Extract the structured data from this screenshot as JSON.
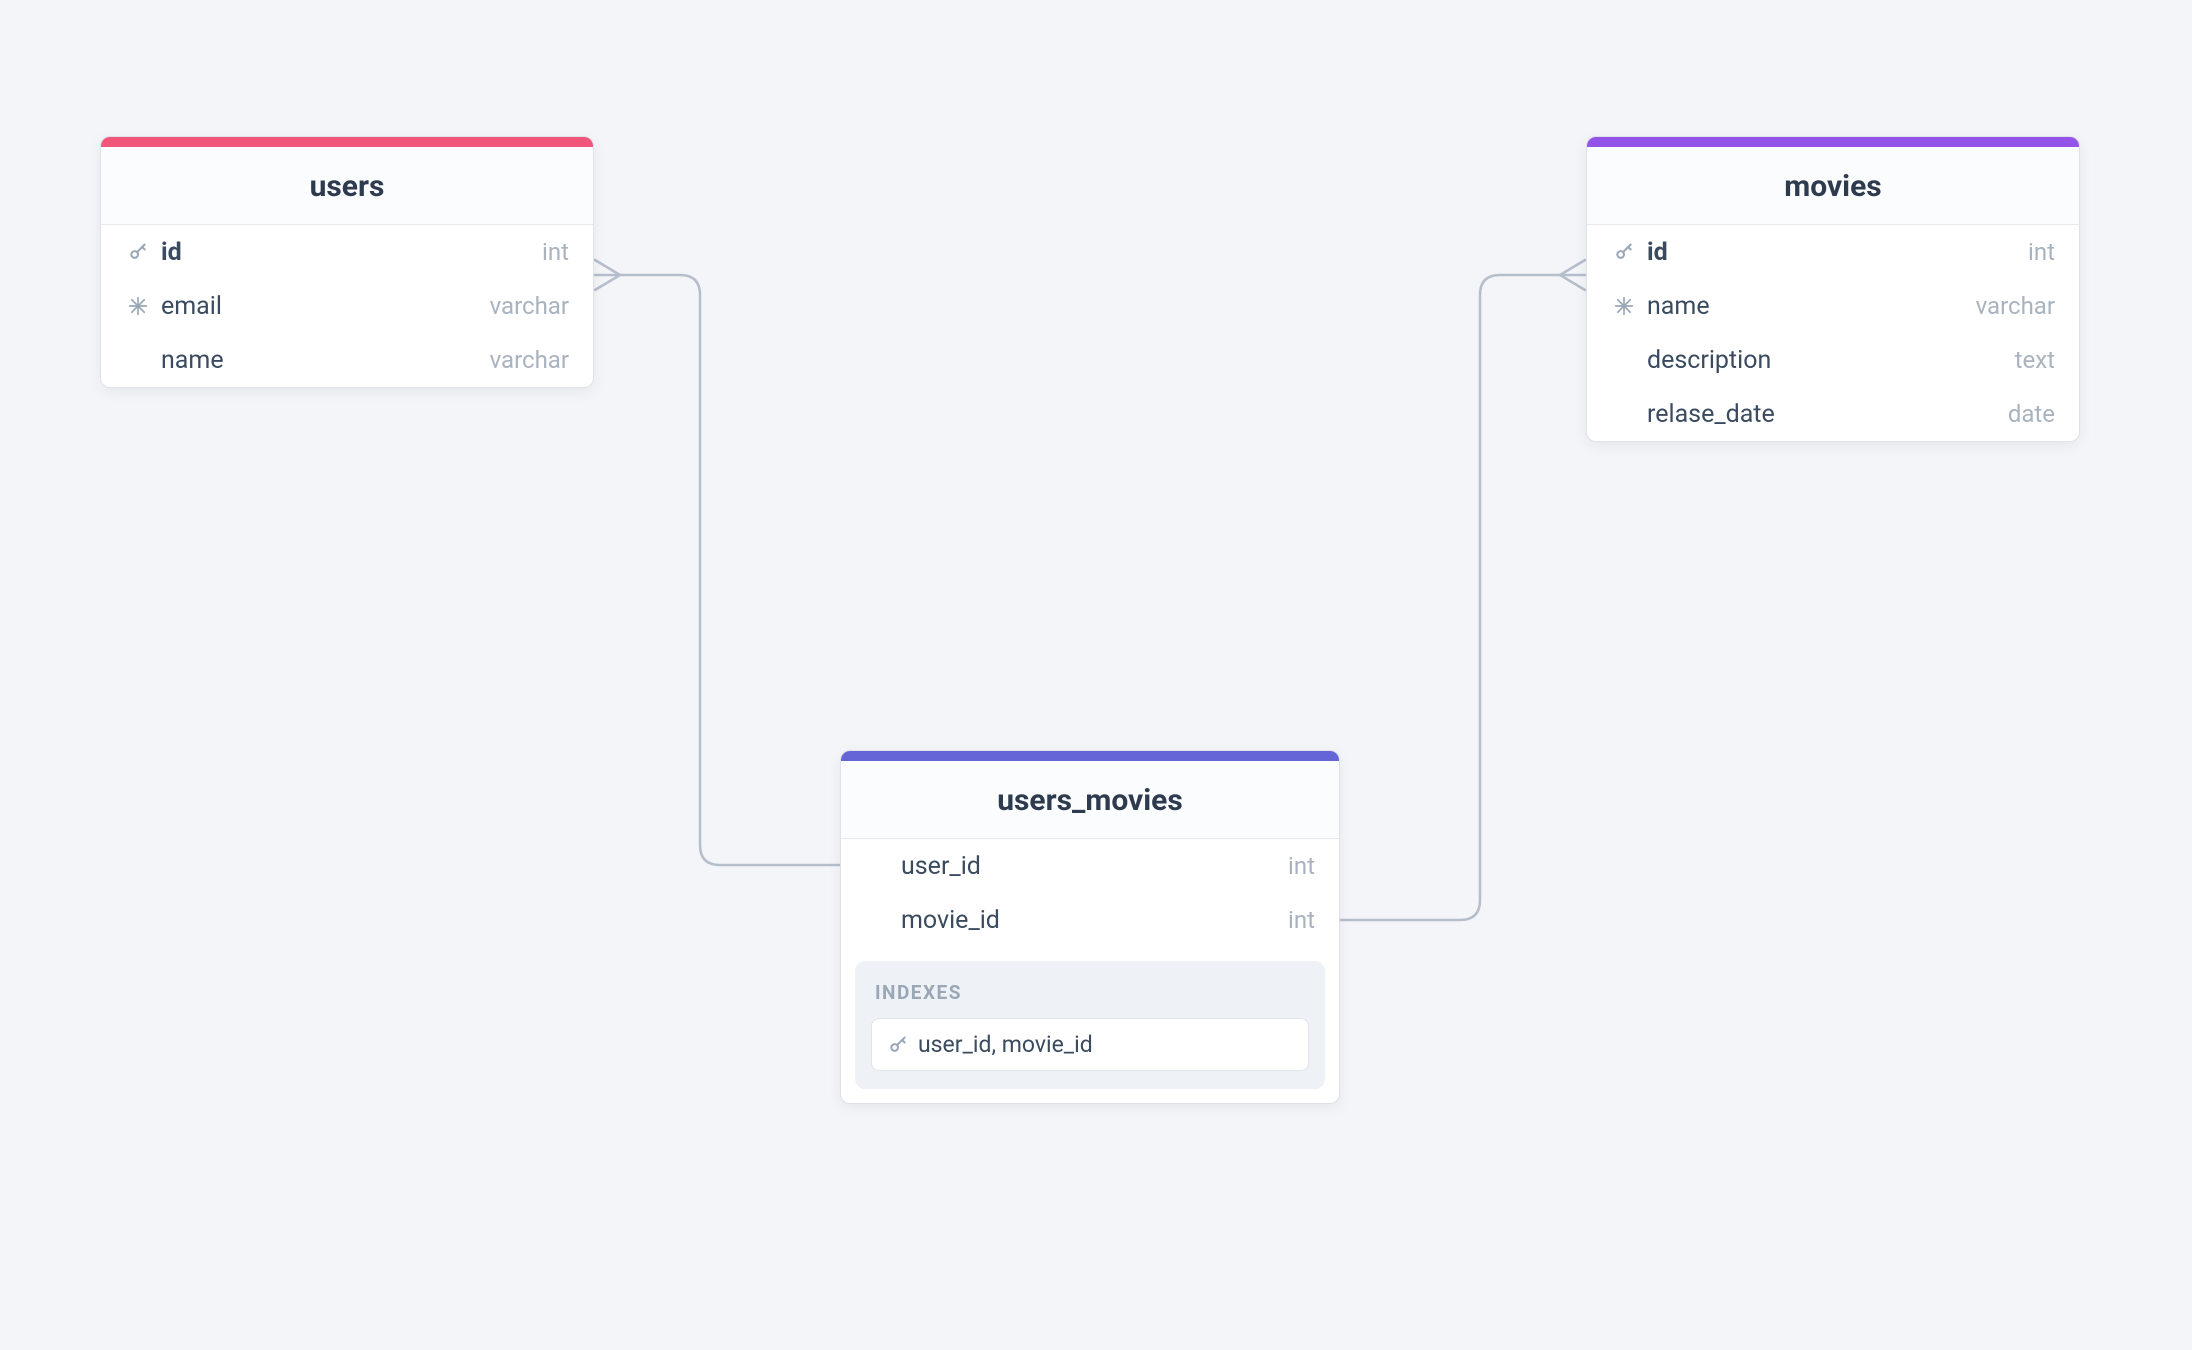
{
  "colors": {
    "pink": "#f2557a",
    "purple": "#9554e9",
    "indigo": "#6565d8"
  },
  "tables": {
    "users": {
      "title": "users",
      "columns": [
        {
          "icon": "key",
          "name": "id",
          "type": "int",
          "bold": true
        },
        {
          "icon": "snow",
          "name": "email",
          "type": "varchar",
          "bold": false
        },
        {
          "icon": "",
          "name": "name",
          "type": "varchar",
          "bold": false
        }
      ]
    },
    "movies": {
      "title": "movies",
      "columns": [
        {
          "icon": "key",
          "name": "id",
          "type": "int",
          "bold": true
        },
        {
          "icon": "snow",
          "name": "name",
          "type": "varchar",
          "bold": false
        },
        {
          "icon": "",
          "name": "description",
          "type": "text",
          "bold": false
        },
        {
          "icon": "",
          "name": "relase_date",
          "type": "date",
          "bold": false
        }
      ]
    },
    "users_movies": {
      "title": "users_movies",
      "columns": [
        {
          "icon": "",
          "name": "user_id",
          "type": "int",
          "bold": false
        },
        {
          "icon": "",
          "name": "movie_id",
          "type": "int",
          "bold": false
        }
      ],
      "indexes": {
        "label": "INDEXES",
        "items": [
          {
            "icon": "key",
            "text": "user_id, movie_id"
          }
        ]
      }
    }
  },
  "relations": [
    {
      "from": "users.id",
      "to": "users_movies.user_id"
    },
    {
      "from": "movies.id",
      "to": "users_movies.movie_id"
    }
  ]
}
